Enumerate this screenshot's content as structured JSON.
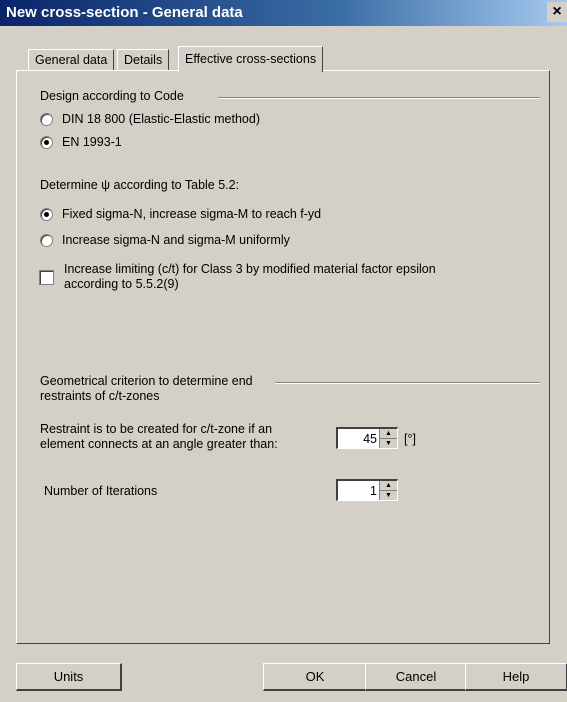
{
  "window": {
    "title": "New cross-section - General data",
    "close_glyph": "×"
  },
  "tabs": [
    {
      "label": "General data",
      "active": false
    },
    {
      "label": "Details",
      "active": false
    },
    {
      "label": "Effective cross-sections",
      "active": true
    }
  ],
  "design_code": {
    "group_label": "Design according to Code",
    "options": [
      {
        "label": "DIN 18 800 (Elastic-Elastic method)",
        "checked": false
      },
      {
        "label": "EN 1993-1",
        "checked": true
      }
    ]
  },
  "psi": {
    "label": "Determine ψ according to Table 5.2:",
    "options": [
      {
        "label": "Fixed sigma-N, increase sigma-M to reach f-yd",
        "checked": true
      },
      {
        "label": "Increase sigma-N and sigma-M uniformly",
        "checked": false
      }
    ],
    "checkbox": {
      "label_line1": "Increase limiting (c/t) for Class 3 by modified material factor epsilon",
      "label_line2": "according to 5.5.2(9)",
      "checked": false
    }
  },
  "geometry": {
    "group_label_line1": "Geometrical criterion to determine end",
    "group_label_line2": "restraints of c/t-zones",
    "restraint_line1": "Restraint is to be created for c/t-zone if an",
    "restraint_line2": "element connects at an angle greater than:",
    "angle_value": "45",
    "angle_unit": "[°]",
    "iterations_label": "Number of Iterations",
    "iterations_value": "1"
  },
  "buttons": {
    "units": "Units",
    "ok": "OK",
    "cancel": "Cancel",
    "help": "Help"
  }
}
